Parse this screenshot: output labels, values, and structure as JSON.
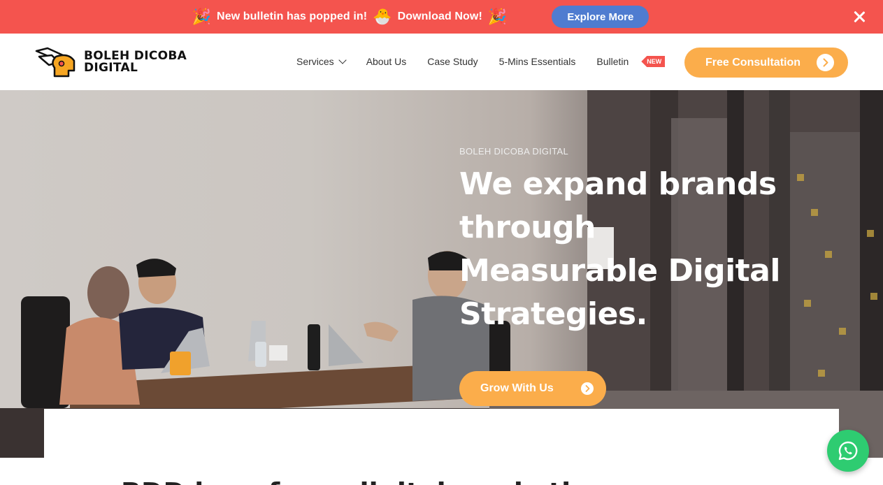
{
  "announcement": {
    "message_left": "New bulletin has popped in!",
    "message_right": "Download Now!",
    "button_label": "Explore More",
    "emoji_confetti": "🎉",
    "emoji_hatching": "🐣",
    "background_color": "#f4544e",
    "button_color": "#4f7cd0"
  },
  "header": {
    "logo_line1": "BOLEH DICOBA",
    "logo_line2": "DIGITAL",
    "nav": {
      "services": "Services",
      "about": "About Us",
      "case_study": "Case Study",
      "essentials": "5-Mins Essentials",
      "bulletin": "Bulletin",
      "new_badge": "NEW"
    },
    "cta_label": "Free Consultation",
    "accent_color": "#fbad4b"
  },
  "hero": {
    "eyebrow": "BOLEH DICOBA DIGITAL",
    "headline_line1": "We expand brands",
    "headline_line2": "through",
    "headline_line3": "Measurable Digital",
    "headline_line4": "Strategies.",
    "button_label": "Grow With Us"
  },
  "section": {
    "peek_text": "BDD is ... for .. digital marketing ... ..."
  },
  "icons": {
    "close": "close-icon",
    "chevron": "chevron-down-icon",
    "arrow": "arrow-right-icon",
    "whatsapp": "whatsapp-icon"
  }
}
